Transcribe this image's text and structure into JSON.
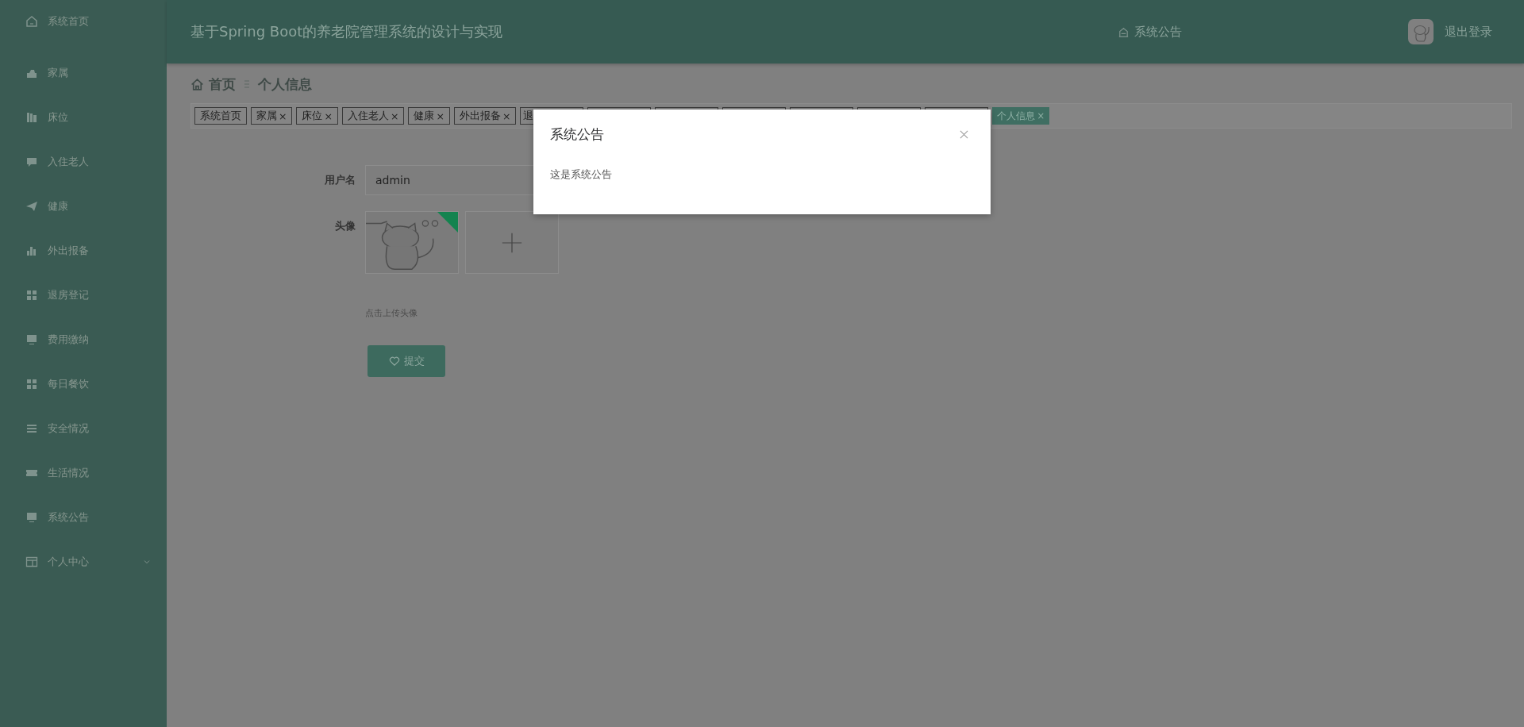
{
  "sidebar": {
    "items": [
      {
        "label": "系统首页"
      },
      {
        "label": "家属"
      },
      {
        "label": "床位"
      },
      {
        "label": "入住老人"
      },
      {
        "label": "健康"
      },
      {
        "label": "外出报备"
      },
      {
        "label": "退房登记"
      },
      {
        "label": "费用缴纳"
      },
      {
        "label": "每日餐饮"
      },
      {
        "label": "安全情况"
      },
      {
        "label": "生活情况"
      },
      {
        "label": "系统公告"
      },
      {
        "label": "个人中心",
        "expanded": false
      }
    ]
  },
  "header": {
    "title": "基于Spring Boot的养老院管理系统的设计与实现",
    "notice_link": "系统公告",
    "logout": "退出登录"
  },
  "breadcrumb": [
    "首页",
    "个人信息"
  ],
  "tags": [
    {
      "label": "系统首页",
      "selected": false
    },
    {
      "label": "家属",
      "close": "×",
      "selected": false
    },
    {
      "label": "床位",
      "close": "×",
      "selected": false
    },
    {
      "label": "入住老人",
      "close": "×",
      "selected": false
    },
    {
      "label": "健康",
      "close": "×",
      "selected": false
    },
    {
      "label": "外出报备",
      "close": "×",
      "selected": false
    },
    {
      "label": "退",
      "selected": false
    },
    {
      "selected": false
    },
    {
      "selected": false
    },
    {
      "selected": false
    },
    {
      "selected": false
    },
    {
      "selected": false
    },
    {
      "selected": false
    },
    {
      "label": "个人信息",
      "close": "×",
      "selected": true
    }
  ],
  "form": {
    "username_label": "用户名",
    "username_value": "admin",
    "avatar_label": "头像",
    "avatar_hint": "点击上传头像",
    "submit": "提交"
  },
  "dialog": {
    "title": "系统公告",
    "body": "这是系统公告"
  }
}
